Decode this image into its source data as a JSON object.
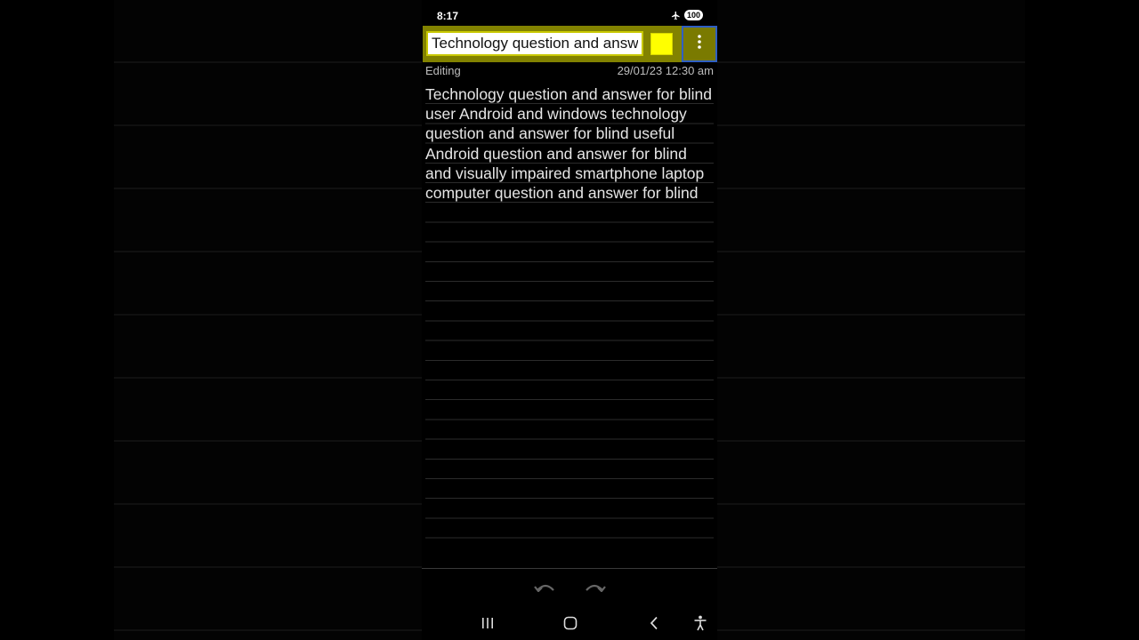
{
  "status_bar": {
    "time": "8:17",
    "battery": "100",
    "icons": [
      "airplane-icon",
      "battery-icon"
    ]
  },
  "toolbar": {
    "title_value": "Technology question and answer for blind",
    "color_swatch": "#ffff00",
    "more_icon": "more-vertical-icon",
    "accent_color": "#828200"
  },
  "meta": {
    "status": "Editing",
    "date": "29/01/23 12:30 am"
  },
  "note": {
    "body": "Technology question and answer for blind user Android and windows technology question and answer for blind useful Android question and answer for blind and visually impaired smartphone laptop computer question and answer for blind"
  },
  "edit_actions": {
    "icons": [
      "undo-icon",
      "redo-icon"
    ]
  },
  "navigation_bar": {
    "icons": [
      "recent-apps-icon",
      "home-icon",
      "back-icon",
      "accessibility-icon"
    ]
  }
}
